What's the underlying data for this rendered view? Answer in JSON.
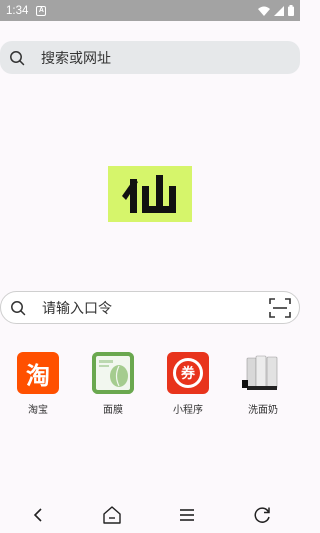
{
  "status_bar": {
    "time": "1:34",
    "notification_glyph": "A",
    "background": "#a3a3a3"
  },
  "top_search": {
    "placeholder": "搜索或网址",
    "icon": "search-icon"
  },
  "logo": {
    "glyph": "仙",
    "background": "#d6f56b"
  },
  "command_search": {
    "placeholder": "请输入口令",
    "icon": "search-icon",
    "scan_icon": "scan-icon"
  },
  "shortcuts": [
    {
      "label": "淘宝",
      "icon": "taobao-icon",
      "glyph": "淘",
      "color": "#ff5000"
    },
    {
      "label": "面膜",
      "icon": "face-mask-icon",
      "color": "#6aa84f"
    },
    {
      "label": "小程序",
      "icon": "coupon-icon",
      "glyph": "券",
      "color": "#e8341c"
    },
    {
      "label": "洗面奶",
      "icon": "cleanser-icon",
      "color": "#333333"
    }
  ],
  "nav_bar": {
    "back": "back-icon",
    "home": "home-icon",
    "menu": "menu-icon",
    "refresh": "refresh-icon"
  }
}
